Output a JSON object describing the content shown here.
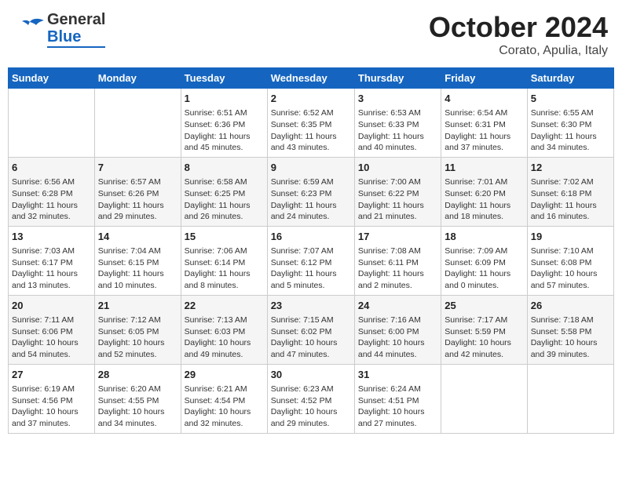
{
  "header": {
    "logo_general": "General",
    "logo_blue": "Blue",
    "month_title": "October 2024",
    "subtitle": "Corato, Apulia, Italy"
  },
  "days_of_week": [
    "Sunday",
    "Monday",
    "Tuesday",
    "Wednesday",
    "Thursday",
    "Friday",
    "Saturday"
  ],
  "weeks": [
    [
      {
        "day": "",
        "info": ""
      },
      {
        "day": "",
        "info": ""
      },
      {
        "day": "1",
        "info": "Sunrise: 6:51 AM\nSunset: 6:36 PM\nDaylight: 11 hours\nand 45 minutes."
      },
      {
        "day": "2",
        "info": "Sunrise: 6:52 AM\nSunset: 6:35 PM\nDaylight: 11 hours\nand 43 minutes."
      },
      {
        "day": "3",
        "info": "Sunrise: 6:53 AM\nSunset: 6:33 PM\nDaylight: 11 hours\nand 40 minutes."
      },
      {
        "day": "4",
        "info": "Sunrise: 6:54 AM\nSunset: 6:31 PM\nDaylight: 11 hours\nand 37 minutes."
      },
      {
        "day": "5",
        "info": "Sunrise: 6:55 AM\nSunset: 6:30 PM\nDaylight: 11 hours\nand 34 minutes."
      }
    ],
    [
      {
        "day": "6",
        "info": "Sunrise: 6:56 AM\nSunset: 6:28 PM\nDaylight: 11 hours\nand 32 minutes."
      },
      {
        "day": "7",
        "info": "Sunrise: 6:57 AM\nSunset: 6:26 PM\nDaylight: 11 hours\nand 29 minutes."
      },
      {
        "day": "8",
        "info": "Sunrise: 6:58 AM\nSunset: 6:25 PM\nDaylight: 11 hours\nand 26 minutes."
      },
      {
        "day": "9",
        "info": "Sunrise: 6:59 AM\nSunset: 6:23 PM\nDaylight: 11 hours\nand 24 minutes."
      },
      {
        "day": "10",
        "info": "Sunrise: 7:00 AM\nSunset: 6:22 PM\nDaylight: 11 hours\nand 21 minutes."
      },
      {
        "day": "11",
        "info": "Sunrise: 7:01 AM\nSunset: 6:20 PM\nDaylight: 11 hours\nand 18 minutes."
      },
      {
        "day": "12",
        "info": "Sunrise: 7:02 AM\nSunset: 6:18 PM\nDaylight: 11 hours\nand 16 minutes."
      }
    ],
    [
      {
        "day": "13",
        "info": "Sunrise: 7:03 AM\nSunset: 6:17 PM\nDaylight: 11 hours\nand 13 minutes."
      },
      {
        "day": "14",
        "info": "Sunrise: 7:04 AM\nSunset: 6:15 PM\nDaylight: 11 hours\nand 10 minutes."
      },
      {
        "day": "15",
        "info": "Sunrise: 7:06 AM\nSunset: 6:14 PM\nDaylight: 11 hours\nand 8 minutes."
      },
      {
        "day": "16",
        "info": "Sunrise: 7:07 AM\nSunset: 6:12 PM\nDaylight: 11 hours\nand 5 minutes."
      },
      {
        "day": "17",
        "info": "Sunrise: 7:08 AM\nSunset: 6:11 PM\nDaylight: 11 hours\nand 2 minutes."
      },
      {
        "day": "18",
        "info": "Sunrise: 7:09 AM\nSunset: 6:09 PM\nDaylight: 11 hours\nand 0 minutes."
      },
      {
        "day": "19",
        "info": "Sunrise: 7:10 AM\nSunset: 6:08 PM\nDaylight: 10 hours\nand 57 minutes."
      }
    ],
    [
      {
        "day": "20",
        "info": "Sunrise: 7:11 AM\nSunset: 6:06 PM\nDaylight: 10 hours\nand 54 minutes."
      },
      {
        "day": "21",
        "info": "Sunrise: 7:12 AM\nSunset: 6:05 PM\nDaylight: 10 hours\nand 52 minutes."
      },
      {
        "day": "22",
        "info": "Sunrise: 7:13 AM\nSunset: 6:03 PM\nDaylight: 10 hours\nand 49 minutes."
      },
      {
        "day": "23",
        "info": "Sunrise: 7:15 AM\nSunset: 6:02 PM\nDaylight: 10 hours\nand 47 minutes."
      },
      {
        "day": "24",
        "info": "Sunrise: 7:16 AM\nSunset: 6:00 PM\nDaylight: 10 hours\nand 44 minutes."
      },
      {
        "day": "25",
        "info": "Sunrise: 7:17 AM\nSunset: 5:59 PM\nDaylight: 10 hours\nand 42 minutes."
      },
      {
        "day": "26",
        "info": "Sunrise: 7:18 AM\nSunset: 5:58 PM\nDaylight: 10 hours\nand 39 minutes."
      }
    ],
    [
      {
        "day": "27",
        "info": "Sunrise: 6:19 AM\nSunset: 4:56 PM\nDaylight: 10 hours\nand 37 minutes."
      },
      {
        "day": "28",
        "info": "Sunrise: 6:20 AM\nSunset: 4:55 PM\nDaylight: 10 hours\nand 34 minutes."
      },
      {
        "day": "29",
        "info": "Sunrise: 6:21 AM\nSunset: 4:54 PM\nDaylight: 10 hours\nand 32 minutes."
      },
      {
        "day": "30",
        "info": "Sunrise: 6:23 AM\nSunset: 4:52 PM\nDaylight: 10 hours\nand 29 minutes."
      },
      {
        "day": "31",
        "info": "Sunrise: 6:24 AM\nSunset: 4:51 PM\nDaylight: 10 hours\nand 27 minutes."
      },
      {
        "day": "",
        "info": ""
      },
      {
        "day": "",
        "info": ""
      }
    ]
  ]
}
